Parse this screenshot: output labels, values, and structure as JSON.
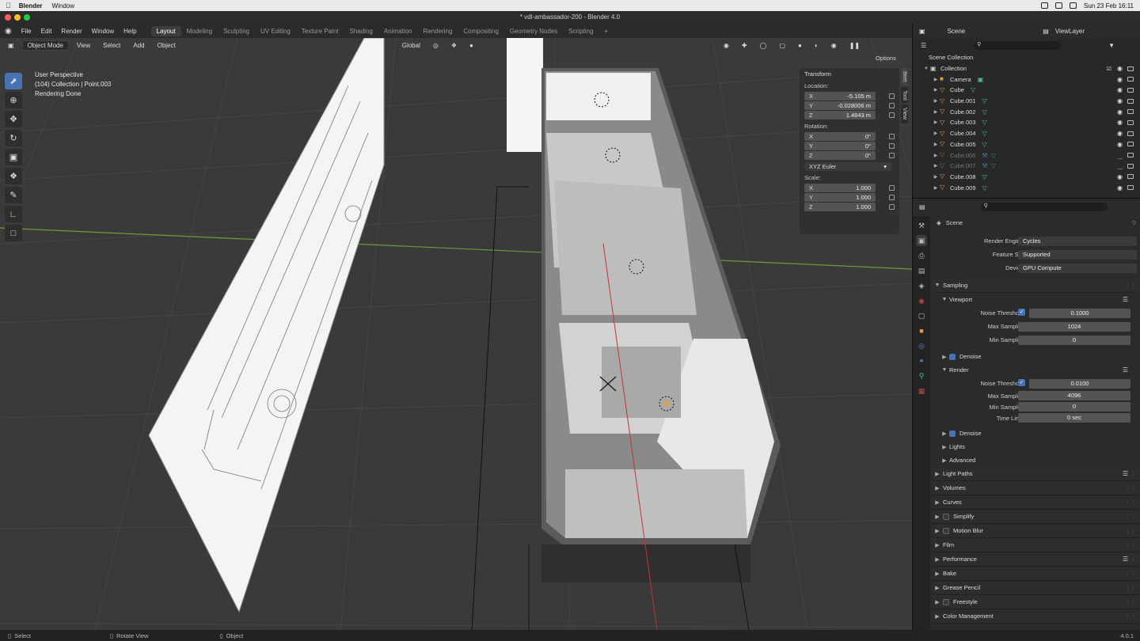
{
  "macmenu": {
    "app": "Blender",
    "window": "Window",
    "datetime": "Sun 23 Feb  16:11"
  },
  "window_title": "* vdl-ambassador-200 - Blender 4.0",
  "menu": [
    "File",
    "Edit",
    "Render",
    "Window",
    "Help"
  ],
  "workspaces": [
    "Layout",
    "Modeling",
    "Sculpting",
    "UV Editing",
    "Texture Paint",
    "Shading",
    "Animation",
    "Rendering",
    "Compositing",
    "Geometry Nodes",
    "Scripting"
  ],
  "active_workspace": "Layout",
  "viewport_header": {
    "mode": "Object Mode",
    "view": "View",
    "select": "Select",
    "add": "Add",
    "object": "Object",
    "orientation": "Global",
    "options": "Options"
  },
  "overlay": {
    "line1": "User Perspective",
    "line2": "(104) Collection | Point.003",
    "line3": "Rendering Done"
  },
  "transform": {
    "title": "Transform",
    "location_label": "Location:",
    "location": [
      {
        "axis": "X",
        "value": "-5.105 m"
      },
      {
        "axis": "Y",
        "value": "-0.028006 m"
      },
      {
        "axis": "Z",
        "value": "1.4843 m"
      }
    ],
    "rotation_label": "Rotation:",
    "rotation": [
      {
        "axis": "X",
        "value": "0°"
      },
      {
        "axis": "Y",
        "value": "0°"
      },
      {
        "axis": "Z",
        "value": "0°"
      }
    ],
    "rotation_mode": "XYZ Euler",
    "scale_label": "Scale:",
    "scale": [
      {
        "axis": "X",
        "value": "1.000"
      },
      {
        "axis": "Y",
        "value": "1.000"
      },
      {
        "axis": "Z",
        "value": "1.000"
      }
    ]
  },
  "npanel_tabs": [
    "Item",
    "Tool",
    "View"
  ],
  "outliner": {
    "scene": "Scene",
    "view_layer": "ViewLayer",
    "root": "Scene Collection",
    "collection": "Collection",
    "items": [
      {
        "name": "Camera",
        "dim": false
      },
      {
        "name": "Cube",
        "dim": false
      },
      {
        "name": "Cube.001",
        "dim": false
      },
      {
        "name": "Cube.002",
        "dim": false
      },
      {
        "name": "Cube.003",
        "dim": false
      },
      {
        "name": "Cube.004",
        "dim": false
      },
      {
        "name": "Cube.005",
        "dim": false
      },
      {
        "name": "Cube.006",
        "dim": true
      },
      {
        "name": "Cube.007",
        "dim": true
      },
      {
        "name": "Cube.008",
        "dim": false
      },
      {
        "name": "Cube.009",
        "dim": false
      }
    ]
  },
  "properties": {
    "context": "Scene",
    "render_engine_label": "Render Engine",
    "render_engine": "Cycles",
    "feature_set_label": "Feature Set",
    "feature_set": "Supported",
    "device_label": "Device",
    "device": "GPU Compute",
    "sampling": "Sampling",
    "viewport": "Viewport",
    "noise_threshold_label": "Noise Threshold",
    "viewport_noise_threshold": "0.1000",
    "max_samples_label": "Max Samples",
    "viewport_max_samples": "1024",
    "min_samples_label": "Min Samples",
    "viewport_min_samples": "0",
    "denoise": "Denoise",
    "render": "Render",
    "render_noise_threshold": "0.0100",
    "render_max_samples": "4096",
    "render_min_samples": "0",
    "time_limit_label": "Time Limit",
    "time_limit": "0 sec",
    "lights": "Lights",
    "advanced": "Advanced",
    "panels": [
      "Light Paths",
      "Volumes",
      "Curves",
      "Simplify",
      "Motion Blur",
      "Film",
      "Performance",
      "Bake",
      "Grease Pencil",
      "Freestyle",
      "Color Management"
    ]
  },
  "status": {
    "select": "Select",
    "rotate": "Rotate View",
    "object": "Object",
    "version": "4.0.1"
  }
}
